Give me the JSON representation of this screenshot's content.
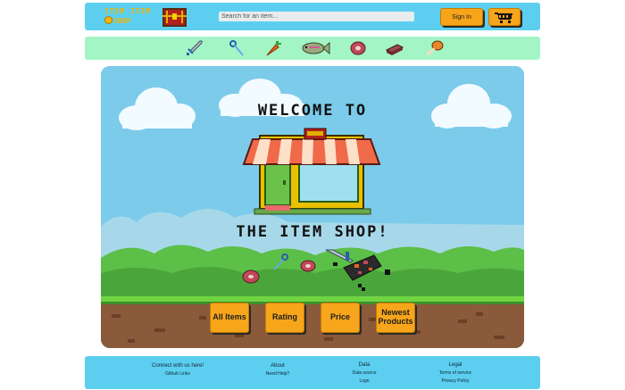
{
  "header": {
    "logo_line1": "ITEM ITEM",
    "logo_line2": "SHOP",
    "search_placeholder": "Search for an item...",
    "signin_label": "Sign In"
  },
  "categories": [
    "sword",
    "wand",
    "carrot",
    "fish",
    "meat",
    "ingot",
    "drumstick"
  ],
  "hero": {
    "title_top": "WELCOME TO",
    "title_bottom": "THE ITEM SHOP!",
    "buttons": [
      {
        "label": "All Items"
      },
      {
        "label": "Rating"
      },
      {
        "label": "Price"
      },
      {
        "label": "Newest Products"
      }
    ]
  },
  "footer": {
    "col1": {
      "head": "Connect with us here!",
      "links": [
        "Github Links"
      ]
    },
    "col2": {
      "head": "About",
      "links": [
        "Need Help?"
      ]
    },
    "col3": {
      "head": "Data",
      "links": [
        "Data source",
        "Logo"
      ]
    },
    "col4": {
      "head": "Legal",
      "links": [
        "Terms of service",
        "Privacy Policy"
      ]
    }
  },
  "colors": {
    "header_bg": "#5ccff0",
    "category_bg": "#a3f5c6",
    "button_orange": "#f7a51b",
    "sky": "#7ccbea"
  }
}
